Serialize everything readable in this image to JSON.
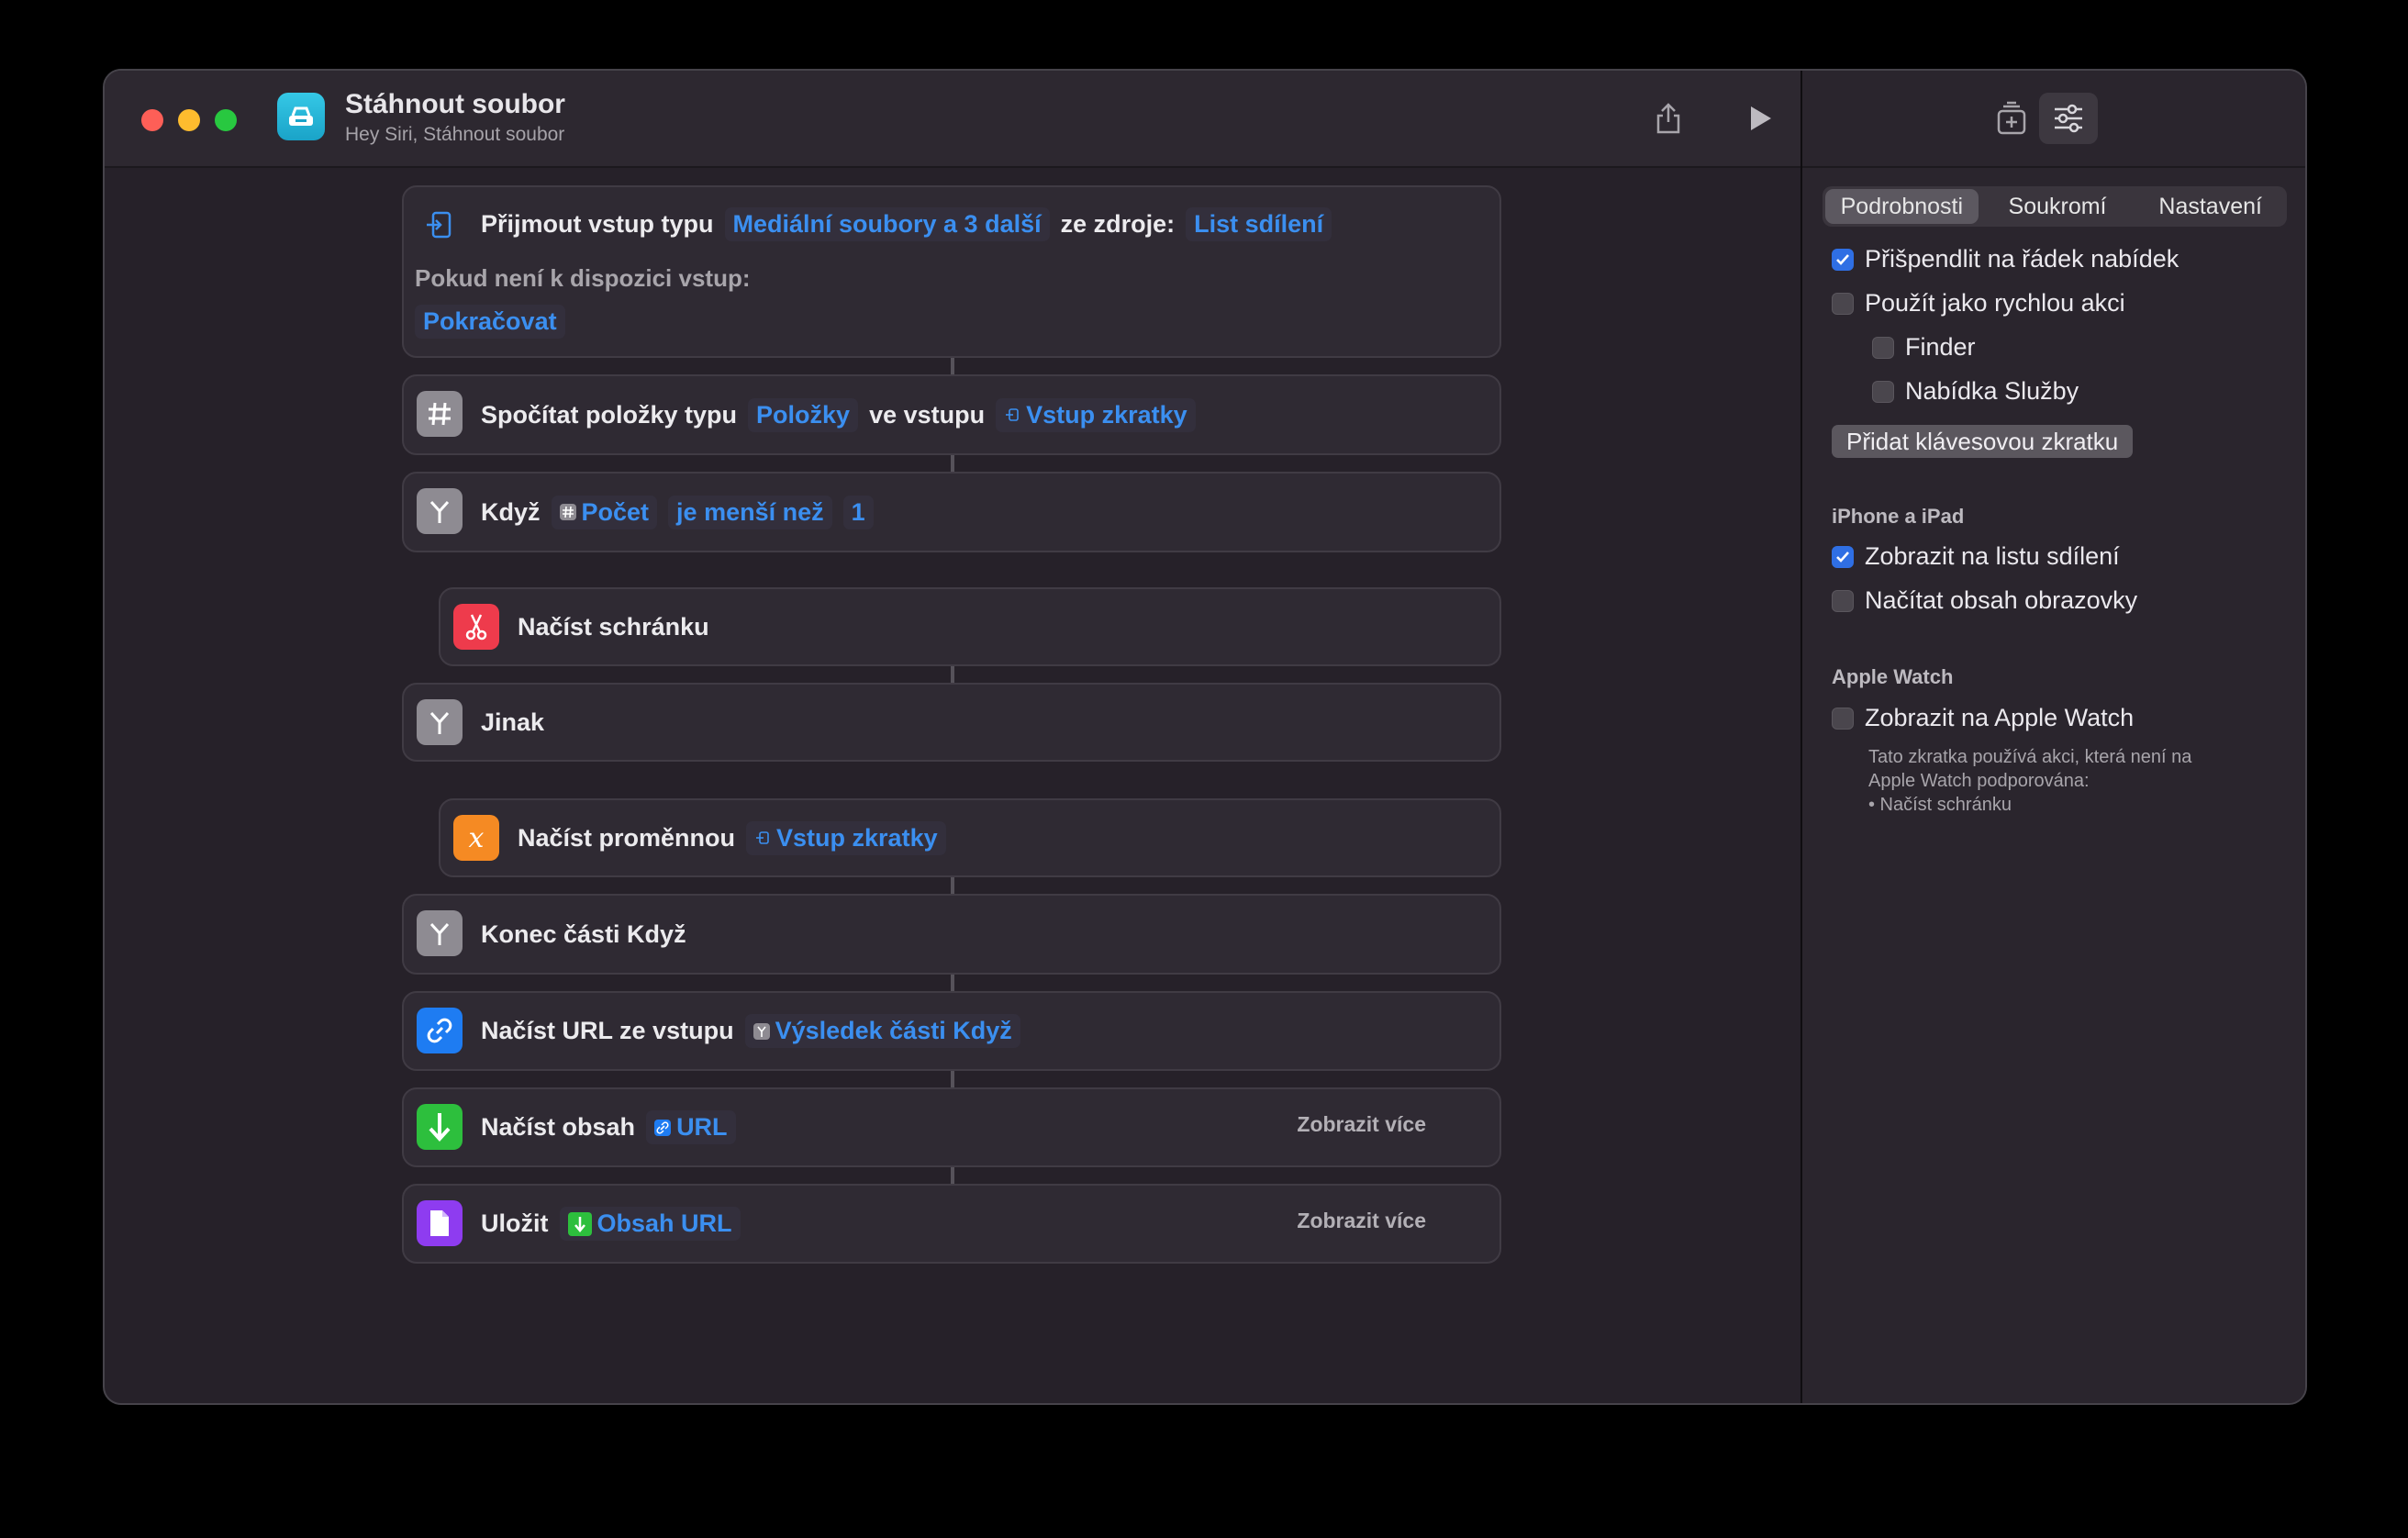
{
  "window": {
    "title": "Stáhnout soubor",
    "subtitle": "Hey Siri, Stáhnout soubor"
  },
  "colors": {
    "accent": "#3b8ff0",
    "panel": "#262129"
  },
  "actions": [
    {
      "label": "Přijmout vstup typu",
      "token1": "Mediální soubory a 3 další",
      "middle": "ze zdroje:",
      "token2": "List sdílení",
      "fallback_label": "Pokud není k dispozici vstup:",
      "fallback_token": "Pokračovat",
      "icon": "receive-input-icon"
    },
    {
      "label": "Spočítat položky typu",
      "token1": "Položky",
      "middle": "ve vstupu",
      "token2": "Vstup zkratky",
      "icon": "hash-icon"
    },
    {
      "label": "Když",
      "token1": "Počet",
      "token2": "je menší než",
      "token3": "1",
      "icon": "branch-icon"
    },
    {
      "label": "Načíst schránku",
      "icon": "scissors-icon"
    },
    {
      "label": "Jinak",
      "icon": "branch-icon"
    },
    {
      "label": "Načíst proměnnou",
      "token1": "Vstup zkratky",
      "icon": "variable-icon"
    },
    {
      "label": "Konec části Když",
      "icon": "branch-icon"
    },
    {
      "label": "Načíst URL ze vstupu",
      "token1": "Výsledek části Když",
      "icon": "link-icon"
    },
    {
      "label": "Načíst obsah",
      "token1": "URL",
      "show_more": "Zobrazit více",
      "icon": "download-icon"
    },
    {
      "label": "Uložit",
      "token1": "Obsah URL",
      "show_more": "Zobrazit více",
      "icon": "document-icon"
    }
  ],
  "sidebar": {
    "tabs": [
      "Podrobnosti",
      "Soukromí",
      "Nastavení"
    ],
    "active_tab": "Podrobnosti",
    "options": [
      {
        "label": "Přišpendlit na řádek nabídek",
        "checked": true
      },
      {
        "label": "Použít jako rychlou akci",
        "checked": false
      },
      {
        "label": "Finder",
        "checked": false
      },
      {
        "label": "Nabídka Služby",
        "checked": false
      }
    ],
    "shortcut_button": "Přidat klávesovou zkratku",
    "iphone_section": "iPhone a iPad",
    "iphone_options": [
      {
        "label": "Zobrazit na listu sdílení",
        "checked": true
      },
      {
        "label": "Načítat obsah obrazovky",
        "checked": false
      }
    ],
    "watch_section": "Apple Watch",
    "watch_option": {
      "label": "Zobrazit na Apple Watch",
      "checked": false
    },
    "watch_note_1": "Tato zkratka používá akci, která není na",
    "watch_note_2": "Apple Watch podporována:",
    "watch_note_3": "• Načíst schránku"
  }
}
